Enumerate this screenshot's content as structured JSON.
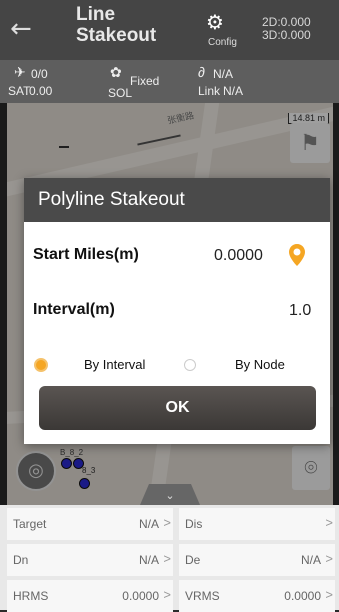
{
  "header": {
    "title": "Line Stakeout",
    "config_label": "Config",
    "coord_2d": "2D:0.000",
    "coord_3d": "3D:0.000"
  },
  "status": {
    "sat_value": "0/0",
    "sat_label": "SAT",
    "sat_number": "0.00",
    "sol_value": "Fixed",
    "sol_label": "SOL",
    "link_value": "N/A",
    "link_label": "Link",
    "link_sub": "N/A"
  },
  "map": {
    "road_label": "张衡路",
    "scale": "14.81 m",
    "points": [
      "B_2",
      "8_3"
    ],
    "point_prefix": "B_8_2"
  },
  "dialog": {
    "title": "Polyline Stakeout",
    "start_label": "Start Miles(m)",
    "start_value": "0.0000",
    "interval_label": "Interval(m)",
    "interval_value": "1.0",
    "option_interval": "By Interval",
    "option_node": "By Node",
    "ok_label": "OK"
  },
  "grid": {
    "target_label": "Target",
    "target_value": "N/A",
    "dis_label": "Dis",
    "dis_value": "",
    "dn_label": "Dn",
    "dn_value": "N/A",
    "de_label": "De",
    "de_value": "N/A",
    "hrms_label": "HRMS",
    "hrms_value": "0.0000",
    "vrms_label": "VRMS",
    "vrms_value": "0.0000"
  },
  "colors": {
    "accent": "#f5a623",
    "header": "#454545",
    "status": "#5e5e5e"
  }
}
